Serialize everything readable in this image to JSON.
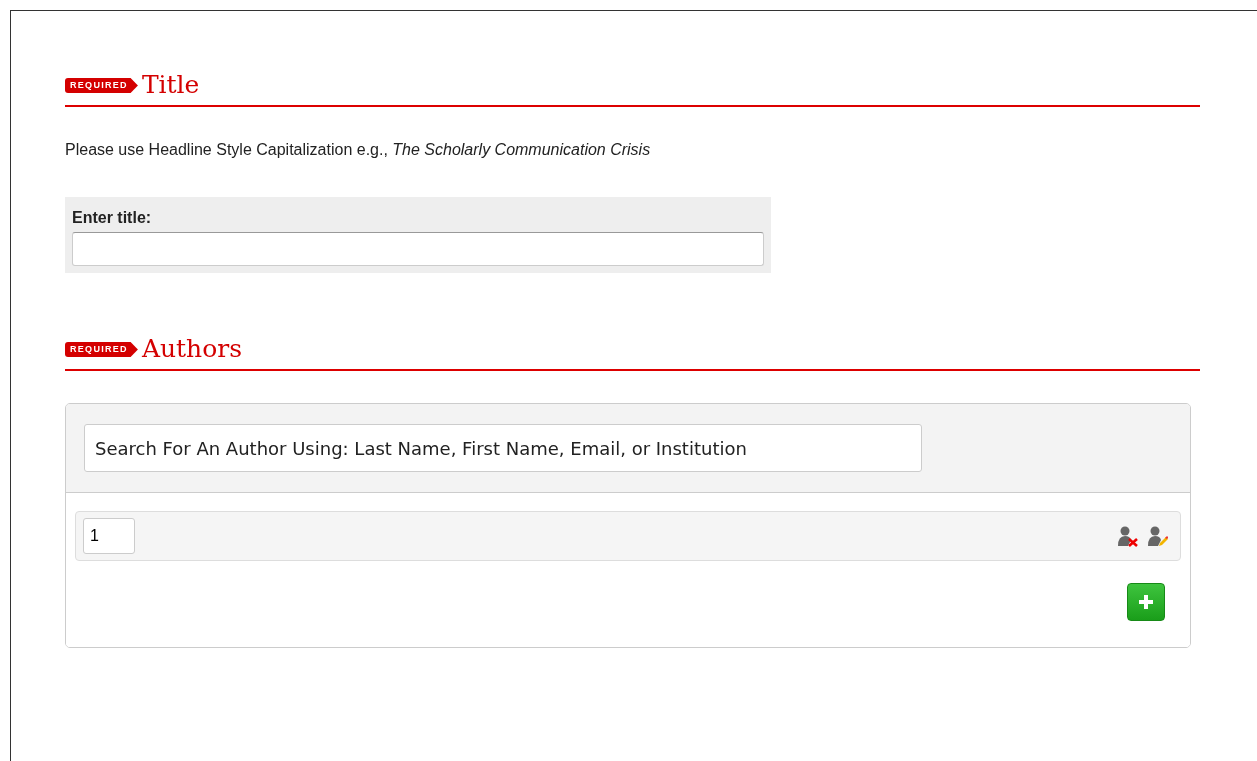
{
  "sections": [
    {
      "badge": "REQUIRED",
      "heading": "Title",
      "kind": "title",
      "hint": "Please use Headline Style Capitalization e.g., *The Scholarly Communication Crisis*",
      "field_label": "Enter title:"
    },
    {
      "badge": "REQUIRED",
      "heading": "Authors",
      "kind": "authors",
      "search": {
        "placeholder": "Search For An Author Using: Last Name, First Name, Email, or Institution"
      },
      "authors": [
        {
          "order": "1"
        }
      ]
    }
  ]
}
